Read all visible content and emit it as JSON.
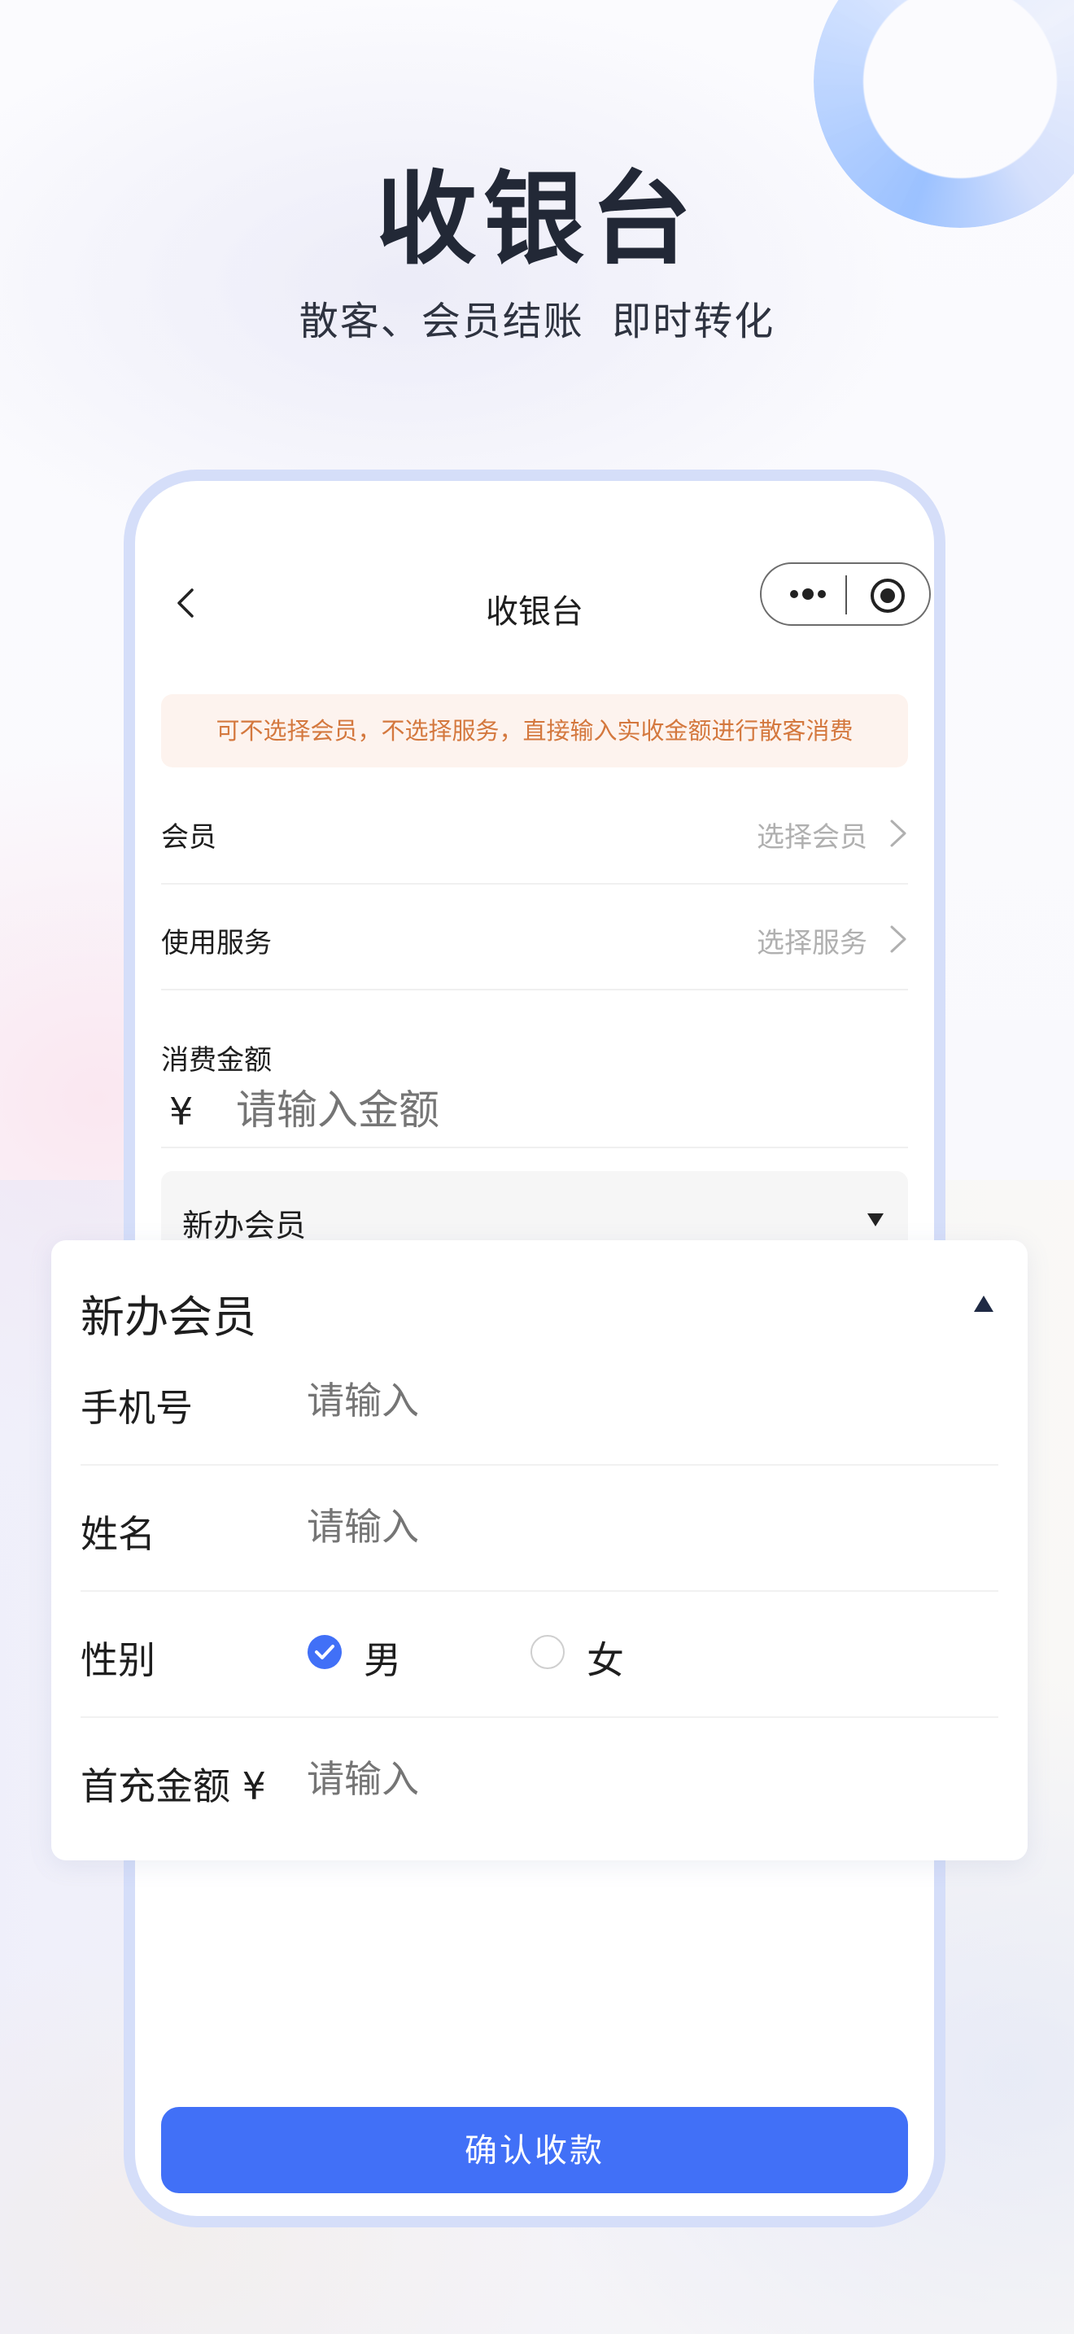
{
  "hero": {
    "title": "收银台",
    "subtitle": "散客、会员结账  即时转化"
  },
  "navbar": {
    "title": "收银台",
    "back_icon": "chevron-left-icon",
    "capsule_icons": [
      "more-dots-icon",
      "target-icon"
    ]
  },
  "notice": {
    "text": "可不选择会员，不选择服务，直接输入实收金额进行散客消费"
  },
  "rows": {
    "member": {
      "label": "会员",
      "value": "选择会员"
    },
    "service": {
      "label": "使用服务",
      "value": "选择服务"
    }
  },
  "amount": {
    "label": "消费金额",
    "currency": "¥",
    "placeholder": "请输入金额"
  },
  "new_member_collapsed": {
    "label": "新办会员"
  },
  "new_member_card": {
    "title": "新办会员",
    "phone": {
      "label": "手机号",
      "placeholder": "请输入"
    },
    "name": {
      "label": "姓名",
      "placeholder": "请输入"
    },
    "gender": {
      "label": "性别",
      "options": [
        {
          "label": "男",
          "selected": true
        },
        {
          "label": "女",
          "selected": false
        }
      ]
    },
    "topup": {
      "label": "首充金额 ¥",
      "placeholder": "请输入"
    }
  },
  "confirm_button": {
    "label": "确认收款"
  },
  "colors": {
    "primary": "#4170f7",
    "notice_text": "#d4783e",
    "notice_bg": "#fdf3ee",
    "phone_frame": "#d5def9"
  }
}
